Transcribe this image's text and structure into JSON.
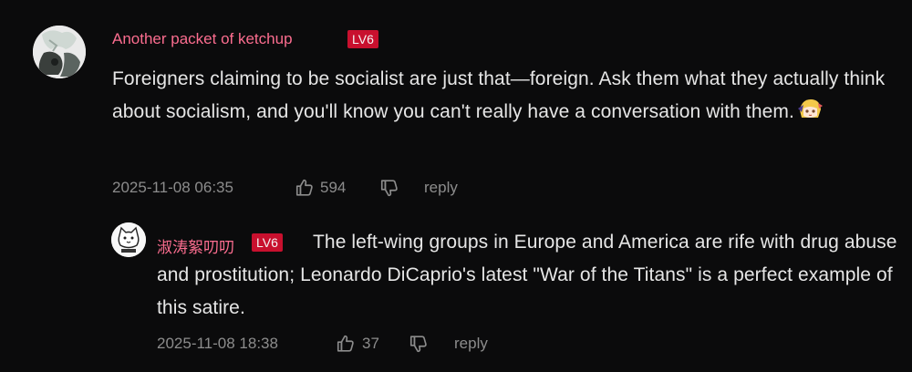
{
  "comments": [
    {
      "username": "Another packet of ketchup",
      "level": "LV6",
      "text": "Foreigners claiming to be socialist are just that—foreign. Ask them what they actually think about socialism, and you'll know you can't really have a conversation with them.",
      "timestamp": "2025-11-08 06:35",
      "likes": "594",
      "reply_label": "reply",
      "avatar_icon": "user-avatar",
      "emoji_icon": "anime-girl-emoji"
    },
    {
      "username": "淑涛絮叨叨",
      "level": "LV6",
      "text": "The left-wing groups in Europe and America are rife with drug abuse and prostitution; Leonardo DiCaprio's latest \"War of the Titans\" is a perfect example of this satire.",
      "timestamp": "2025-11-08 18:38",
      "likes": "37",
      "reply_label": "reply",
      "avatar_icon": "cartoon-cat-avatar"
    }
  ],
  "colors": {
    "background": "#0b0b0c",
    "username": "#fb6d8f",
    "level_badge": "#c8102e",
    "meta": "#8c8c8c",
    "text": "#e6e6e6"
  }
}
